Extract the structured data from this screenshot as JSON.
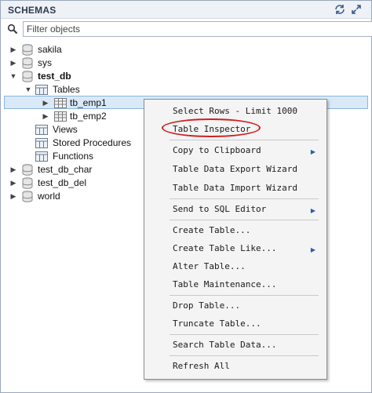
{
  "header": {
    "title": "SCHEMAS",
    "icon1": "refresh-icon",
    "icon2": "expand-icon"
  },
  "filter": {
    "placeholder": "Filter objects",
    "value": ""
  },
  "tree": {
    "sakila": "sakila",
    "sys": "sys",
    "test_db": "test_db",
    "tables": "Tables",
    "tb_emp1": "tb_emp1",
    "tb_emp2": "tb_emp2",
    "views": "Views",
    "stored_procedures": "Stored Procedures",
    "functions": "Functions",
    "test_db_char": "test_db_char",
    "test_db_del": "test_db_del",
    "world": "world"
  },
  "context_menu": {
    "select_rows": "Select Rows - Limit 1000",
    "table_inspector": "Table Inspector",
    "copy_to_clipboard": "Copy to Clipboard",
    "export_wizard": "Table Data Export Wizard",
    "import_wizard": "Table Data Import Wizard",
    "send_to_sql_editor": "Send to SQL Editor",
    "create_table": "Create Table...",
    "create_table_like": "Create Table Like...",
    "alter_table": "Alter Table...",
    "table_maintenance": "Table Maintenance...",
    "drop_table": "Drop Table...",
    "truncate_table": "Truncate Table...",
    "search_table_data": "Search Table Data...",
    "refresh_all": "Refresh All"
  },
  "colors": {
    "selection": "#d9e9f8",
    "annotation": "#d21f1f",
    "accent": "#2a5caa"
  }
}
